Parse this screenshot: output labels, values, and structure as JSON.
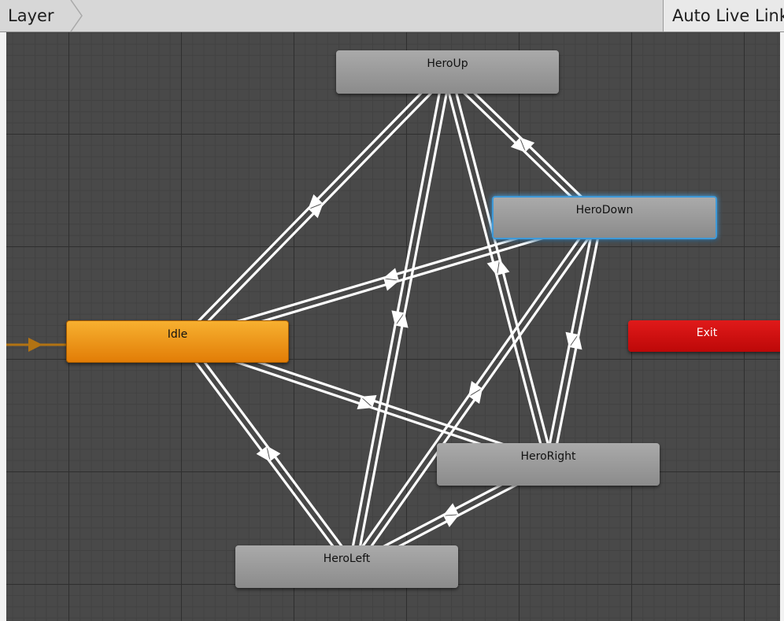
{
  "toolbar": {
    "breadcrumb_label": "Layer",
    "auto_live_link_label": "Auto Live Link"
  },
  "states": {
    "hero_up": "HeroUp",
    "hero_down": "HeroDown",
    "idle": "Idle",
    "exit": "Exit",
    "hero_right": "HeroRight",
    "hero_left": "HeroLeft"
  },
  "colors": {
    "graph_background": "#494949",
    "default_state": "#f0950f",
    "exit_state": "#d41010",
    "state": "#9a9a9a",
    "selected_outline": "#3f9ad9",
    "transition": "#ffffff",
    "entry_transition": "#b27313"
  },
  "transitions": [
    {
      "from": "idle",
      "to": "hero_up"
    },
    {
      "from": "hero_up",
      "to": "idle"
    },
    {
      "from": "idle",
      "to": "hero_down"
    },
    {
      "from": "hero_down",
      "to": "idle"
    },
    {
      "from": "idle",
      "to": "hero_right"
    },
    {
      "from": "hero_right",
      "to": "idle"
    },
    {
      "from": "idle",
      "to": "hero_left"
    },
    {
      "from": "hero_left",
      "to": "idle"
    },
    {
      "from": "hero_up",
      "to": "hero_down"
    },
    {
      "from": "hero_down",
      "to": "hero_up"
    },
    {
      "from": "hero_up",
      "to": "hero_right"
    },
    {
      "from": "hero_right",
      "to": "hero_up"
    },
    {
      "from": "hero_up",
      "to": "hero_left"
    },
    {
      "from": "hero_left",
      "to": "hero_up"
    },
    {
      "from": "hero_down",
      "to": "hero_right"
    },
    {
      "from": "hero_right",
      "to": "hero_down"
    },
    {
      "from": "hero_down",
      "to": "hero_left"
    },
    {
      "from": "hero_left",
      "to": "hero_down"
    },
    {
      "from": "hero_right",
      "to": "hero_left"
    },
    {
      "from": "hero_left",
      "to": "hero_right"
    }
  ]
}
